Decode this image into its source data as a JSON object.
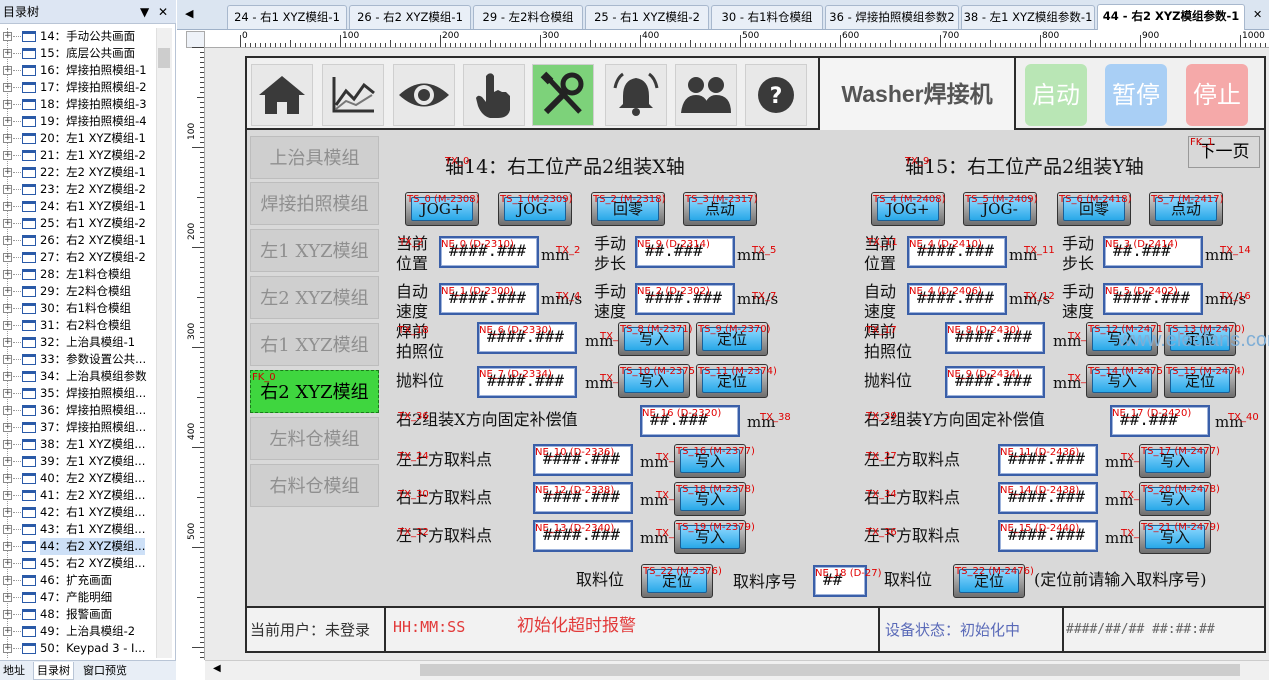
{
  "left_panel": {
    "title": "目录树",
    "close_glyph": "✕",
    "pin_glyph": "▼",
    "items": [
      "14：手动公共画面",
      "15：底层公共画面",
      "16：焊接拍照模组-1",
      "17：焊接拍照模组-2",
      "18：焊接拍照模组-3",
      "19：焊接拍照模组-4",
      "20：左1 XYZ模组-1",
      "21：左1 XYZ模组-2",
      "22：左2 XYZ模组-1",
      "23：左2 XYZ模组-2",
      "24：右1 XYZ模组-1",
      "25：右1 XYZ模组-2",
      "26：右2 XYZ模组-1",
      "27：右2 XYZ模组-2",
      "28：左1料仓模组",
      "29：左2料仓模组",
      "30：右1料仓模组",
      "31：右2料仓模组",
      "32：上治具模组-1",
      "33：参数设置公共...",
      "34：上治具模组参数",
      "35：焊接拍照模组...",
      "36：焊接拍照模组...",
      "37：焊接拍照模组...",
      "38：左1 XYZ模组...",
      "39：左1 XYZ模组...",
      "40：左2 XYZ模组...",
      "41：左2 XYZ模组...",
      "42：右1 XYZ模组...",
      "43：右1 XYZ模组...",
      "44：右2 XYZ模组...",
      "45：右2 XYZ模组...",
      "46：扩充画面",
      "47：产能明细",
      "48：报警画面",
      "49：上治具模组-2",
      "50：Keypad 3 - I..."
    ],
    "bottom_tabs": [
      "地址",
      "目录树",
      "窗口预览"
    ]
  },
  "tabs": {
    "left_arrow": "◀",
    "items": [
      "24 - 右1 XYZ模组-1",
      "26 - 右2 XYZ模组-1",
      "29 - 左2料仓模组",
      "25 - 右1 XYZ模组-2",
      "30 - 右1料仓模组",
      "36 - 焊接拍照模组参数2",
      "38 - 左1 XYZ模组参数-1",
      "44 - 右2 XYZ模组参数-1"
    ],
    "close": "✕"
  },
  "ruler": {
    "h": [
      "0",
      "100",
      "200",
      "300",
      "400",
      "500",
      "600",
      "700",
      "800",
      "900",
      "1000"
    ],
    "v": [
      "100",
      "200",
      "300",
      "400",
      "500"
    ]
  },
  "toolbar_icons": [
    "home-icon",
    "trend-chart-icon",
    "eye-icon",
    "hand-pointer-icon",
    "tools-icon",
    "alarm-bell-icon",
    "users-icon",
    "help-icon"
  ],
  "brand": "Washer焊接机",
  "controls": {
    "start": "启动",
    "pause": "暂停",
    "stop": "停止",
    "start_color": "#b9e6b5",
    "pause_color": "#a9cff5",
    "stop_color": "#f5a9a9"
  },
  "nav": {
    "items": [
      "上治具模组",
      "焊接拍照模组",
      "左1 XYZ模组",
      "左2 XYZ模组",
      "右1 XYZ模组",
      "右2 XYZ模组",
      "左料仓模组",
      "右料仓模组"
    ],
    "active_tag": "FK_0"
  },
  "next_page": {
    "label": "下一页",
    "tag": "FK_1"
  },
  "axis_x": {
    "title": "轴14：右工位产品2组装X轴",
    "tx": "TX_0",
    "jog_plus": "JOG+",
    "jog_minus": "JOG-",
    "home": "回零",
    "inch": "点动",
    "jog_plus_tag": "TS_0 (M-2308)",
    "jog_minus_tag": "TS_1 (M-2309)",
    "home_tag": "TS_2 (M-2318)",
    "inch_tag": "TS_3 (M-2317)",
    "cur_pos": "当前\n位置",
    "cur_pos_tag": "NE_0 (D-2310)",
    "cur_pos_val": "####.###",
    "cur_pos_tx": "TX_2",
    "inch_step": "手动\n步长",
    "inch_step_tag": "NE_9 (D-2314)",
    "inch_step_val": "##.###",
    "inch_step_tx": "TX_5",
    "auto_spd": "自动\n速度",
    "auto_spd_tag": "NE_1 (D-2300)",
    "auto_spd_val": "####.###",
    "auto_spd_tx": "TX_4",
    "man_spd": "手动\n速度",
    "man_spd_tag": "NE_2 (D-2302)",
    "man_spd_val": "####.###",
    "man_spd_tx": "TX_7",
    "photo": "焊前\n拍照位",
    "photo_tag": "NE_6 (D-2330)",
    "photo_val": "####.###",
    "photo_tx": "TX_19",
    "photo_tx2": "TX_18",
    "photo_write_tag": "TS_8 (M-2371)",
    "photo_pos_tag": "TS_9 (M-2370)",
    "throw": "抛料位",
    "throw_tag": "NE_7 (D-2334)",
    "throw_val": "####.###",
    "throw_tx": "TX_21",
    "throw_tx2": "TX_20",
    "throw_write_tag": "TS_10 (M-2375)",
    "throw_pos_tag": "TS_11 (M-2374)",
    "write": "写入",
    "locate": "定位"
  },
  "axis_y": {
    "title": "轴15：右工位产品2组装Y轴",
    "tx": "TX_9",
    "jog_plus_tag": "TS_4 (M-2408)",
    "jog_minus_tag": "TS_5 (M-2409)",
    "home_tag": "TS_6 (M-2418)",
    "inch_tag": "TS_7 (M-2417)",
    "cur_pos_tag": "NE_4 (D-2410)",
    "cur_pos_tx": "TX_11",
    "inch_step_tag": "NE_3 (D-2414)",
    "inch_step_tx": "TX_14",
    "auto_spd_tag": "NE_4 (D-2406)",
    "auto_spd_tx": "TX_12",
    "man_spd_tag": "NE_5 (D-2402)",
    "man_spd_tx": "TX_16",
    "photo_tag": "NE_8 (D-2430)",
    "photo_tx": "TX_22",
    "photo_tx2": "TX_17",
    "photo_write_tag": "TS_12 (M-2471)",
    "photo_pos_tag": "TS_13 (M-2470)",
    "throw_tag": "NE_9 (D-2434)",
    "throw_tx": "TX_23",
    "throw_write_tag": "TS_14 (M-2475)",
    "throw_pos_tag": "TS_15 (M-2474)"
  },
  "units": {
    "mm": "mm",
    "mms": "mm/s"
  },
  "comp_x": {
    "label": "右2组装X方向固定补偿值",
    "tag": "NE_16 (D-2320)",
    "val": "##.###",
    "tx": "TX_38",
    "tx2": "TX_36"
  },
  "comp_y": {
    "label": "右2组装Y方向固定补偿值",
    "tag": "NE_17 (D-2420)",
    "val": "##.###",
    "tx": "TX_40",
    "tx2": "TX_39"
  },
  "pick_x": [
    {
      "label": "左上方取料点",
      "tag": "NE_10 (D-2336)",
      "val": "####.###",
      "tx": "TX_25",
      "tx2": "TX_24",
      "wtag": "TS_16 (M-2377)"
    },
    {
      "label": "右上方取料点",
      "tag": "NE_12 (D-2338)",
      "val": "####.###",
      "tx": "TX_31",
      "tx2": "TX_30",
      "wtag": "TS_18 (M-2378)"
    },
    {
      "label": "左下方取料点",
      "tag": "NE_13 (D-2340)",
      "val": "####.###",
      "tx": "TX_33",
      "tx2": "TX_32",
      "wtag": "TS_19 (M-2379)"
    }
  ],
  "pick_y": [
    {
      "label": "左上方取料点",
      "tag": "NE_11 (D-2436)",
      "val": "####.###",
      "tx": "TX_26",
      "tx2": "TX_27",
      "wtag": "TS_17 (M-2477)"
    },
    {
      "label": "右上方取料点",
      "tag": "NE_14 (D-2438)",
      "val": "####.###",
      "tx": "TX_35",
      "tx2": "TX_34",
      "wtag": "TS_20 (M-2478)"
    },
    {
      "label": "左下方取料点",
      "tag": "NE_15 (D-2440)",
      "val": "####.###",
      "tx": "TX_37",
      "tx2": "TX_36",
      "wtag": "TS_21 (M-2479)"
    }
  ],
  "bottom_row": {
    "pick_pos": "取料位",
    "pos_tag_x": "TS_22 (M-2376)",
    "pick_no": "取料序号",
    "no_tag": "NE_18 (D-27)",
    "no_val": "##",
    "pick_pos2": "取料位",
    "pos_tag_y": "TS_22 (M-2476)",
    "hint": "(定位前请输入取料序号)"
  },
  "status": {
    "user": "当前用户：未登录",
    "time": "HH:MM:SS",
    "alarm": "初始化超时报警",
    "state": "设备状态：初始化中",
    "datetime": "####/##/## ##:##:##"
  },
  "watermark": "www.elecfans.com"
}
